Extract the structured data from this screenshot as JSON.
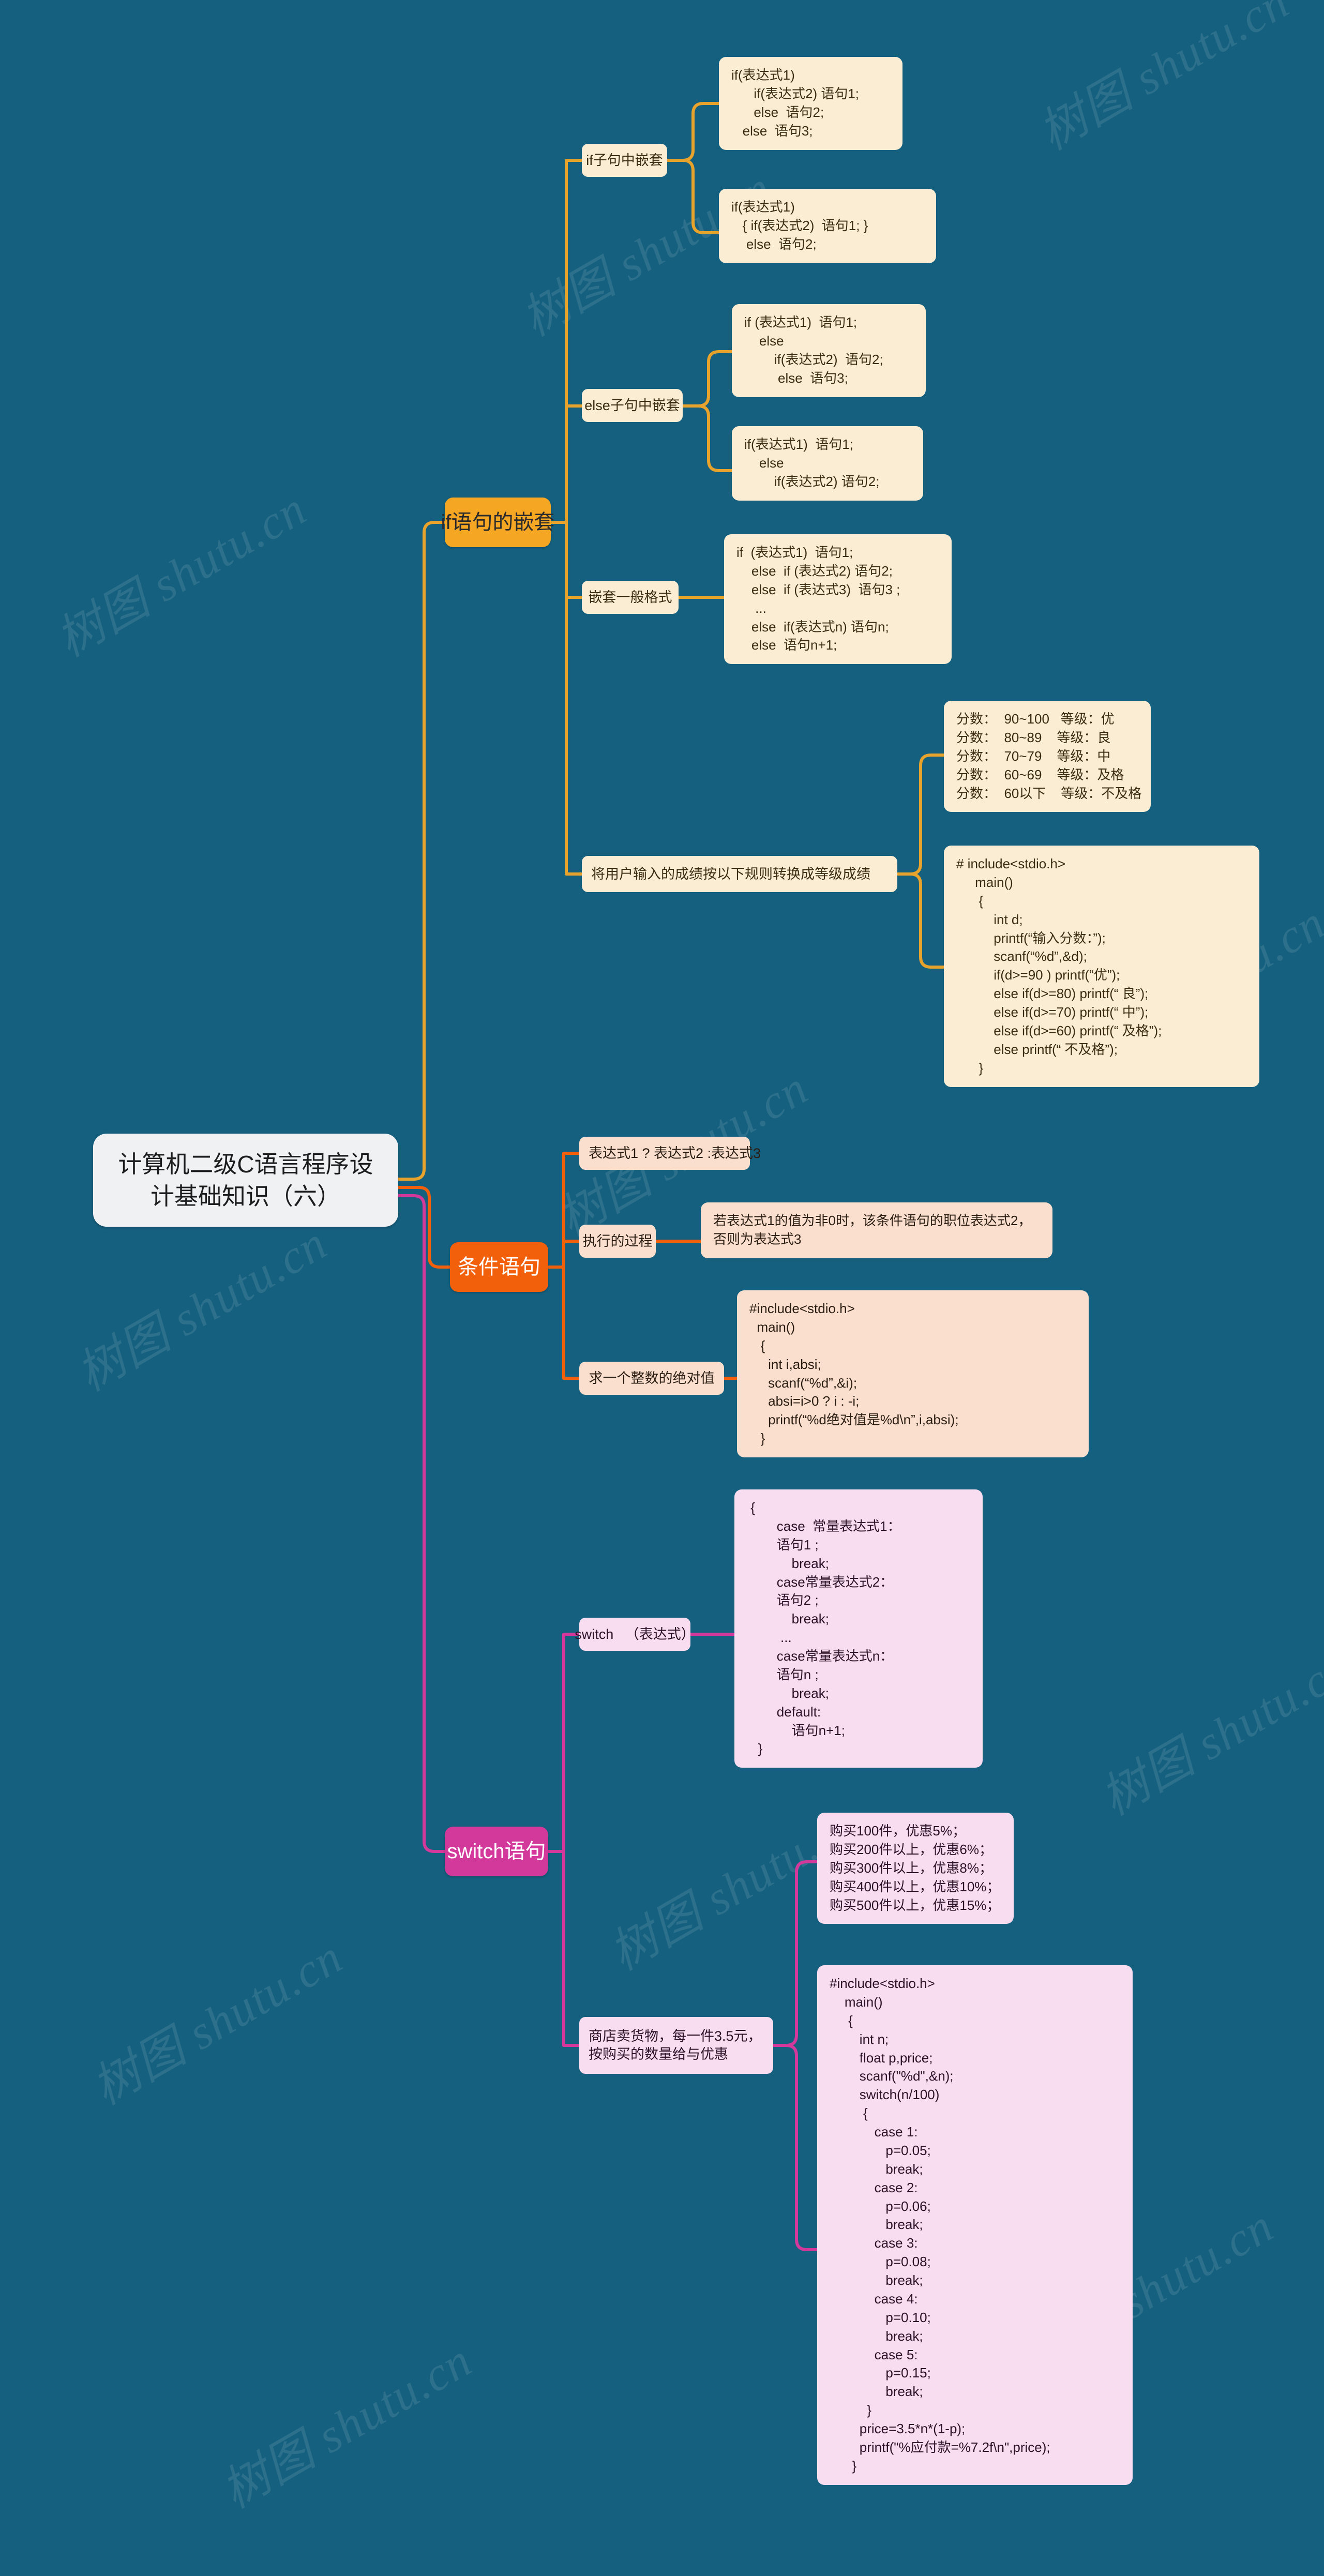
{
  "theme": {
    "background": "#15607f",
    "root_bg": "#f0f1f2",
    "branch_if_color": "#f5a623",
    "branch_cond_color": "#f3600b",
    "branch_switch_color": "#d3399b",
    "leaf_cream": "#fbecd4",
    "leaf_peach": "#fadfce",
    "leaf_pink": "#f8dcef"
  },
  "watermark": {
    "text": "树图 shutu.cn"
  },
  "root": {
    "title": "计算机二级C语言程序设\n计基础知识（六）"
  },
  "branches": [
    {
      "id": "if-nesting",
      "label": "if语句的嵌套",
      "children": [
        {
          "id": "if-clause-nesting",
          "label": "if子句中嵌套",
          "leaves": [
            {
              "id": "if-nest-code-1",
              "text": "if(表达式1)\n      if(表达式2) 语句1;\n      else  语句2;\n   else  语句3;"
            },
            {
              "id": "if-nest-code-2",
              "text": "if(表达式1)\n   { if(表达式2)  语句1; }\n    else  语句2;"
            }
          ]
        },
        {
          "id": "else-clause-nesting",
          "label": "else子句中嵌套",
          "leaves": [
            {
              "id": "else-nest-code-1",
              "text": "if (表达式1)  语句1;\n    else\n        if(表达式2)  语句2;\n         else  语句3;"
            },
            {
              "id": "else-nest-code-2",
              "text": "if(表达式1)  语句1;\n    else\n        if(表达式2) 语句2;"
            }
          ]
        },
        {
          "id": "nesting-general-form",
          "label": "嵌套一般格式",
          "leaves": [
            {
              "id": "nesting-general-code",
              "text": "if  (表达式1)  语句1;\n    else  if (表达式2) 语句2;\n    else  if (表达式3)  语句3 ;\n     ...\n    else  if(表达式n) 语句n;\n    else  语句n+1;"
            }
          ]
        },
        {
          "id": "grade-conversion",
          "label": "将用户输入的成绩按以下规则转换成等级成绩",
          "leaves": [
            {
              "id": "grade-table",
              "text": "分数：  90~100   等级：优\n分数：  80~89    等级：良\n分数：  70~79    等级：中\n分数：  60~69    等级：及格\n分数：  60以下    等级：不及格"
            },
            {
              "id": "grade-code",
              "text": "# include<stdio.h>\n     main()\n      {\n          int d;\n          printf(“输入分数：”);\n          scanf(“%d”,&d);\n          if(d>=90 ) printf(“优”);\n          else if(d>=80) printf(“ 良”);\n          else if(d>=70) printf(“ 中”);\n          else if(d>=60) printf(“ 及格”);\n          else printf(“ 不及格”);\n      }"
            }
          ]
        }
      ]
    },
    {
      "id": "conditional-statement",
      "label": "条件语句",
      "children": [
        {
          "id": "cond-expression-form",
          "label": "表达式1 ? 表达式2 :表达式3",
          "leaves": []
        },
        {
          "id": "cond-execution-process",
          "label": "执行的过程",
          "leaves": [
            {
              "id": "cond-exec-desc",
              "text": "若表达式1的值为非0时，该条件语句的职位表达式2，否则为表达式3",
              "wrap": true
            }
          ]
        },
        {
          "id": "cond-abs-value",
          "label": "求一个整数的绝对值",
          "leaves": [
            {
              "id": "abs-code",
              "text": "#include<stdio.h>\n  main()\n   {\n     int i,absi;\n     scanf(“%d”,&i);\n     absi=i>0 ? i : -i;\n     printf(“%d绝对值是%d\\n”,i,absi);\n   }"
            }
          ]
        }
      ]
    },
    {
      "id": "switch-statement",
      "label": "switch语句",
      "children": [
        {
          "id": "switch-syntax",
          "label": "switch   （表达式）",
          "leaves": [
            {
              "id": "switch-syntax-code",
              "text": " {\n        case  常量表达式1：\n        语句1 ;\n            break;\n        case常量表达式2：\n        语句2 ;\n            break;\n         ...\n        case常量表达式n：\n        语句n ;\n            break;\n        default:\n            语句n+1;\n   }"
            }
          ]
        },
        {
          "id": "shop-discount",
          "label": "商店卖货物，每一件3.5元，\n按购买的数量给与优惠",
          "leaves": [
            {
              "id": "discount-table",
              "text": "购买100件，优惠5%；\n购买200件以上，优惠6%；\n购买300件以上，优惠8%；\n购买400件以上，优惠10%；\n购买500件以上，优惠15%；"
            },
            {
              "id": "discount-code",
              "text": "#include<stdio.h>\n    main()\n     {\n        int n;\n        float p,price;\n        scanf(\"%d\",&n);\n        switch(n/100)\n         {\n            case 1:\n               p=0.05;\n               break;\n            case 2:\n               p=0.06;\n               break;\n            case 3:\n               p=0.08;\n               break;\n            case 4:\n               p=0.10;\n               break;\n            case 5:\n               p=0.15;\n               break;\n          }\n        price=3.5*n*(1-p);\n        printf(\"%应付款=%7.2f\\n\",price);\n      }"
            }
          ]
        }
      ]
    }
  ]
}
